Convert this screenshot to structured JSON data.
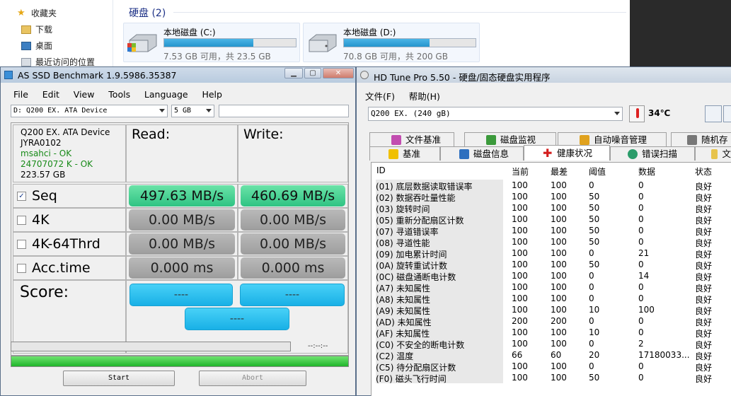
{
  "explorer": {
    "nav": [
      {
        "label": "收藏夹",
        "icon": "star-icon"
      },
      {
        "label": "下载",
        "icon": "folder-icon"
      },
      {
        "label": "桌面",
        "icon": "desktop-icon"
      },
      {
        "label": "最近访问的位置",
        "icon": "recent-icon"
      }
    ],
    "section": "硬盘 (2)",
    "drives": [
      {
        "name": "本地磁盘 (C:)",
        "free": "7.53 GB 可用，共 23.5 GB",
        "used_fraction": 0.68
      },
      {
        "name": "本地磁盘 (D:)",
        "free": "70.8 GB 可用，共 200 GB",
        "used_fraction": 0.65
      }
    ]
  },
  "asssd": {
    "title": "AS SSD Benchmark 1.9.5986.35387",
    "menu": [
      "File",
      "Edit",
      "View",
      "Tools",
      "Language",
      "Help"
    ],
    "drive_select": "D: Q200 EX. ATA Device",
    "size_select": "5 GB",
    "info": {
      "model": "Q200 EX. ATA Device",
      "fw": "JYRA0102",
      "driver": "msahci - OK",
      "align": "24707072 K - OK",
      "capacity": "223.57 GB"
    },
    "read_header": "Read:",
    "write_header": "Write:",
    "rows": [
      {
        "label": "Seq",
        "checked": true,
        "read": "497.63 MB/s",
        "write": "460.69 MB/s"
      },
      {
        "label": "4K",
        "checked": false,
        "read": "0.00 MB/s",
        "write": "0.00 MB/s"
      },
      {
        "label": "4K-64Thrd",
        "checked": false,
        "read": "0.00 MB/s",
        "write": "0.00 MB/s"
      },
      {
        "label": "Acc.time",
        "checked": false,
        "read": "0.000 ms",
        "write": "0.000 ms"
      }
    ],
    "score_label": "Score:",
    "score_read": "----",
    "score_write": "----",
    "score_total": "----",
    "elapsed": "--:--:--",
    "check_mark": "✓",
    "start": "Start",
    "abort": "Abort"
  },
  "hdtune": {
    "title": "HD Tune Pro 5.50 - 硬盘/固态硬盘实用程序",
    "menu": [
      "文件(F)",
      "帮助(H)"
    ],
    "drive_select": "Q200 EX.  (240 gB)",
    "temp": "34℃",
    "tabs_row1": [
      "文件基准",
      "磁盘监视",
      "自动噪音管理",
      "随机存"
    ],
    "tabs_row2": [
      "基准",
      "磁盘信息",
      "健康状况",
      "错误扫描",
      "文"
    ],
    "columns": [
      "ID",
      "当前",
      "最差",
      "阈值",
      "数据",
      "状态"
    ],
    "rows": [
      [
        "(01) 底层数据读取错误率",
        "100",
        "100",
        "0",
        "0",
        "良好"
      ],
      [
        "(02) 数据吞吐量性能",
        "100",
        "100",
        "50",
        "0",
        "良好"
      ],
      [
        "(03) 旋转时间",
        "100",
        "100",
        "50",
        "0",
        "良好"
      ],
      [
        "(05) 重新分配扇区计数",
        "100",
        "100",
        "50",
        "0",
        "良好"
      ],
      [
        "(07) 寻道错误率",
        "100",
        "100",
        "50",
        "0",
        "良好"
      ],
      [
        "(08) 寻道性能",
        "100",
        "100",
        "50",
        "0",
        "良好"
      ],
      [
        "(09) 加电累计时间",
        "100",
        "100",
        "0",
        "21",
        "良好"
      ],
      [
        "(0A) 旋转重试计数",
        "100",
        "100",
        "50",
        "0",
        "良好"
      ],
      [
        "(0C) 磁盘通断电计数",
        "100",
        "100",
        "0",
        "14",
        "良好"
      ],
      [
        "(A7) 未知属性",
        "100",
        "100",
        "0",
        "0",
        "良好"
      ],
      [
        "(A8) 未知属性",
        "100",
        "100",
        "0",
        "0",
        "良好"
      ],
      [
        "(A9) 未知属性",
        "100",
        "100",
        "10",
        "100",
        "良好"
      ],
      [
        "(AD) 未知属性",
        "200",
        "200",
        "0",
        "0",
        "良好"
      ],
      [
        "(AF) 未知属性",
        "100",
        "100",
        "10",
        "0",
        "良好"
      ],
      [
        "(C0) 不安全的断电计数",
        "100",
        "100",
        "0",
        "2",
        "良好"
      ],
      [
        "(C2) 温度",
        "66",
        "60",
        "20",
        "17180033...",
        "良好"
      ],
      [
        "(C5) 待分配扇区计数",
        "100",
        "100",
        "0",
        "0",
        "良好"
      ],
      [
        "(F0) 磁头飞行时间",
        "100",
        "100",
        "50",
        "0",
        "良好"
      ]
    ]
  }
}
